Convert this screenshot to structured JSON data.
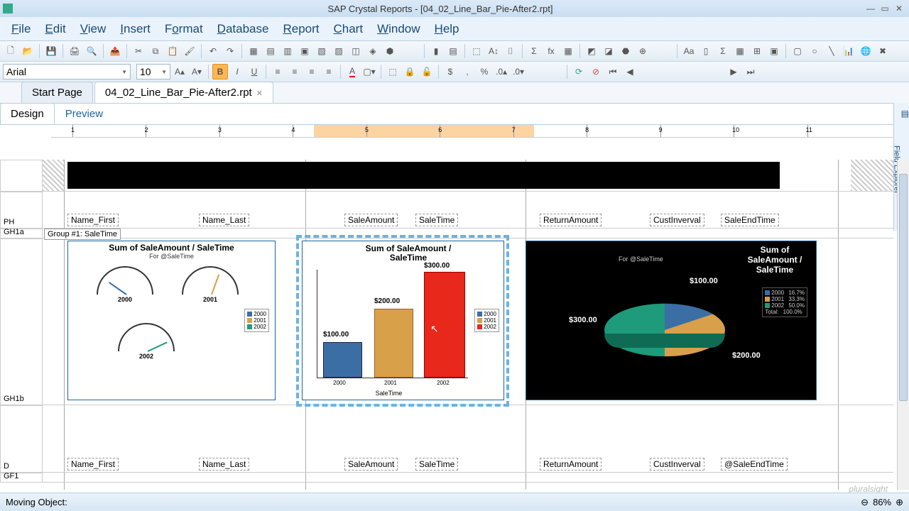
{
  "window": {
    "title": "SAP Crystal Reports - [04_02_Line_Bar_Pie-After2.rpt]"
  },
  "menu": {
    "file": "File",
    "edit": "Edit",
    "view": "View",
    "insert": "Insert",
    "format": "Format",
    "database": "Database",
    "report": "Report",
    "chart": "Chart",
    "window": "Window",
    "help": "Help"
  },
  "format_toolbar": {
    "font": "Arial",
    "size": "10"
  },
  "tabs": {
    "startpage": "Start Page",
    "report": "04_02_Line_Bar_Pie-After2.rpt"
  },
  "view_tabs": {
    "design": "Design",
    "preview": "Preview"
  },
  "side_panel": {
    "label": "Field Explorer"
  },
  "sections": {
    "ph": "PH",
    "gh1a": "GH1a",
    "gh1b": "GH1b",
    "d": "D",
    "gf1": "GF1"
  },
  "group_header": "Group #1: SaleTime",
  "fields": {
    "name_first": "Name_First",
    "name_last": "Name_Last",
    "sale_amount": "SaleAmount",
    "sale_time": "SaleTime",
    "return_amount": "ReturnAmount",
    "cust_interval": "CustInverval",
    "sale_end_time": "SaleEndTime",
    "at_sale_end_time": "@SaleEndTime"
  },
  "chart_data": [
    {
      "type": "gauge",
      "title": "Sum of SaleAmount / SaleTime",
      "subtitle": "For @SaleTime",
      "series": [
        {
          "name": "2000",
          "value": 100,
          "max": 320
        },
        {
          "name": "2001",
          "value": 200,
          "max": 320
        },
        {
          "name": "2002",
          "value": 300,
          "max": 320
        }
      ],
      "legend": [
        "2000",
        "2001",
        "2002"
      ]
    },
    {
      "type": "bar",
      "title": "Sum of SaleAmount / SaleTime",
      "xlabel": "SaleTime",
      "categories": [
        "2000",
        "2001",
        "2002"
      ],
      "values": [
        100,
        200,
        300
      ],
      "value_labels": [
        "$100.00",
        "$200.00",
        "$300.00"
      ],
      "ylim": [
        0,
        320
      ],
      "legend": [
        "2000",
        "2001",
        "2002"
      ],
      "colors": [
        "#3b6ea5",
        "#d9a04a",
        "#e8281b"
      ]
    },
    {
      "type": "pie",
      "title": "Sum of SaleAmount / SaleTime",
      "subtitle": "For @SaleTime",
      "slices": [
        {
          "name": "2000",
          "value": 100,
          "label": "$100.00",
          "pct": "16.7%",
          "color": "#3b6ea5"
        },
        {
          "name": "2001",
          "value": 200,
          "label": "$200.00",
          "pct": "33.3%",
          "color": "#d9a04a"
        },
        {
          "name": "2002",
          "value": 300,
          "label": "$300.00",
          "pct": "50.0%",
          "color": "#1d9b7a"
        }
      ],
      "total": "100.0%"
    }
  ],
  "status": {
    "msg": "Moving Object:",
    "zoom": "86%"
  },
  "watermark": "pluralsight"
}
